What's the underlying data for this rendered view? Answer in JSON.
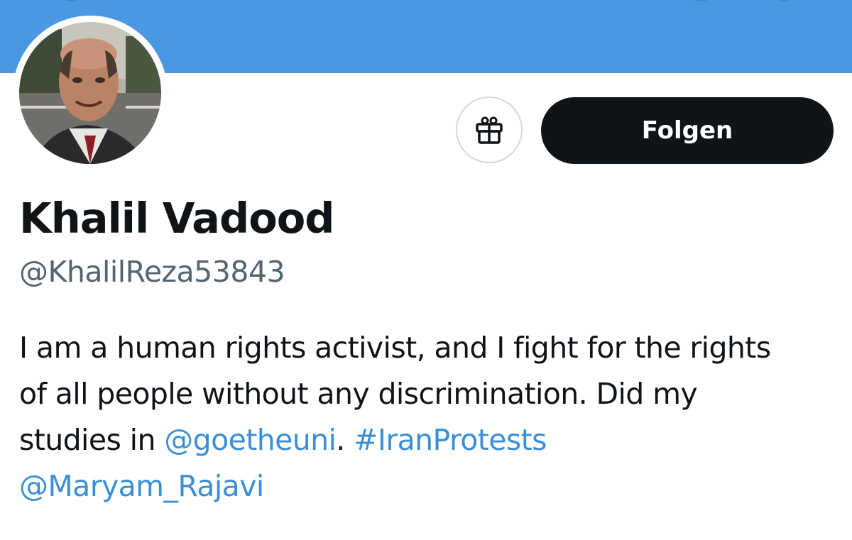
{
  "profile": {
    "display_name": "Khalil Vadood",
    "handle": "@KhalilReza53843",
    "avatar_icon": "profile-photo"
  },
  "actions": {
    "gift_icon": "gift-icon",
    "follow_label": "Folgen"
  },
  "bio": {
    "line1": "I am a human rights activist, and I fight for the rights",
    "line2": "of all people without any discrimination. Did my",
    "line3_text": "studies in ",
    "mention_goethe": "@goetheuni",
    "line3_sep": ". ",
    "hashtag": "#IranProtests",
    "mention_maryam": "@Maryam_Rajavi"
  },
  "colors": {
    "banner": "#4a98e2",
    "follow_button": "#0f1419",
    "link": "#3b8fd6",
    "secondary_text": "#536471"
  }
}
